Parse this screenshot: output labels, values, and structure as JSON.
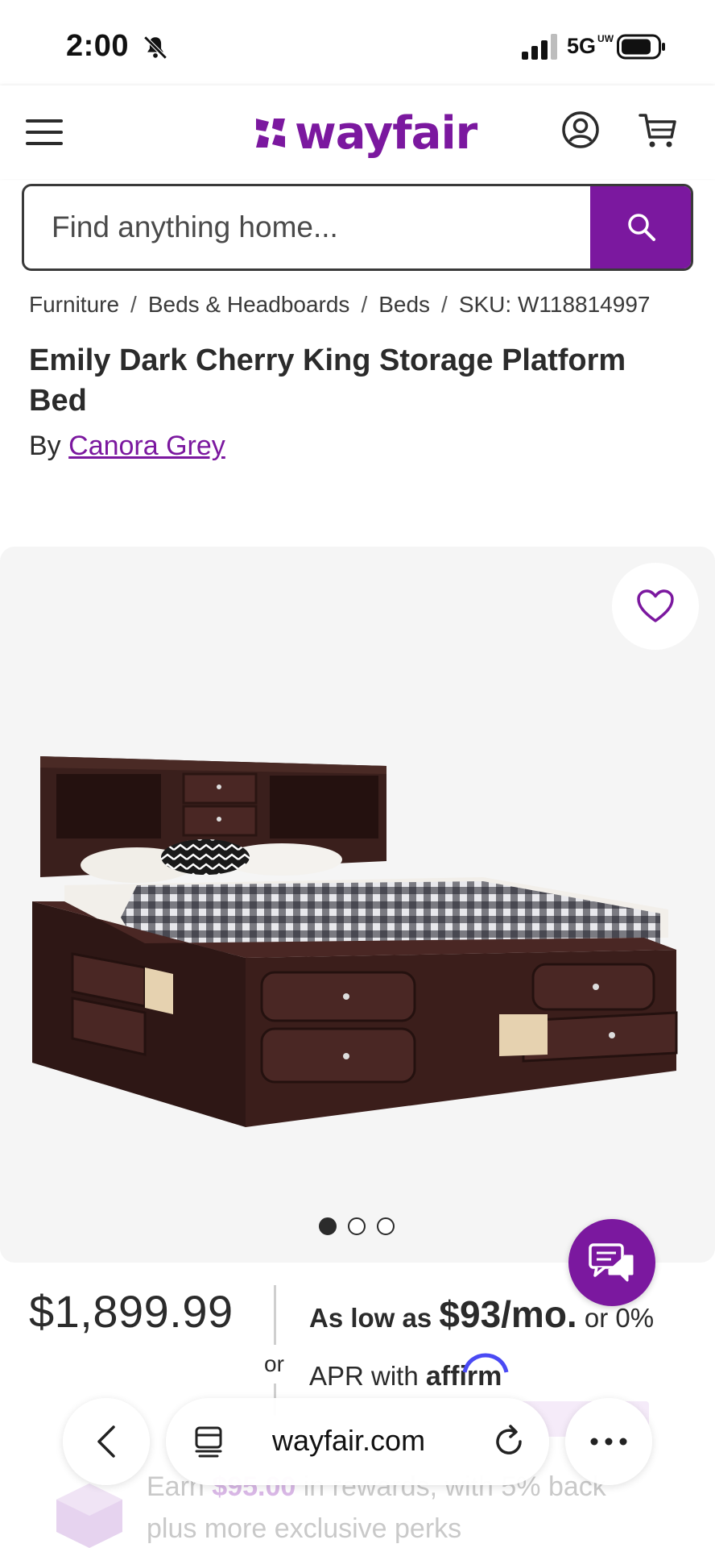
{
  "status_bar": {
    "time": "2:00",
    "network": "5G",
    "network_badge": "UW"
  },
  "header": {
    "logo_text": "wayfair"
  },
  "search": {
    "placeholder": "Find anything home..."
  },
  "breadcrumb": {
    "items": [
      "Furniture",
      "Beds & Headboards",
      "Beds",
      "SKU: W118814997"
    ],
    "separator": "/"
  },
  "product": {
    "title": "Emily Dark Cherry King Storage Platform Bed",
    "by_label": "By",
    "brand": "Canora Grey",
    "price": "$1,899.99",
    "or_label": "or",
    "financing": {
      "prefix": "As low as",
      "monthly": "$93/mo.",
      "suffix": "or 0%",
      "line2": "APR with",
      "provider": "affirm"
    }
  },
  "gallery": {
    "image_count": 3,
    "active_index": 0
  },
  "rewards": {
    "line1_start": "Earn",
    "line1_amount": "$95.00",
    "line1_end": "in rewards, with 5% back",
    "line2": "plus more exclusive perks"
  },
  "browser": {
    "url": "wayfair.com"
  },
  "colors": {
    "brand_purple": "#7b189f",
    "text": "#2b2b2b",
    "gallery_bg": "#f5f5f5"
  }
}
